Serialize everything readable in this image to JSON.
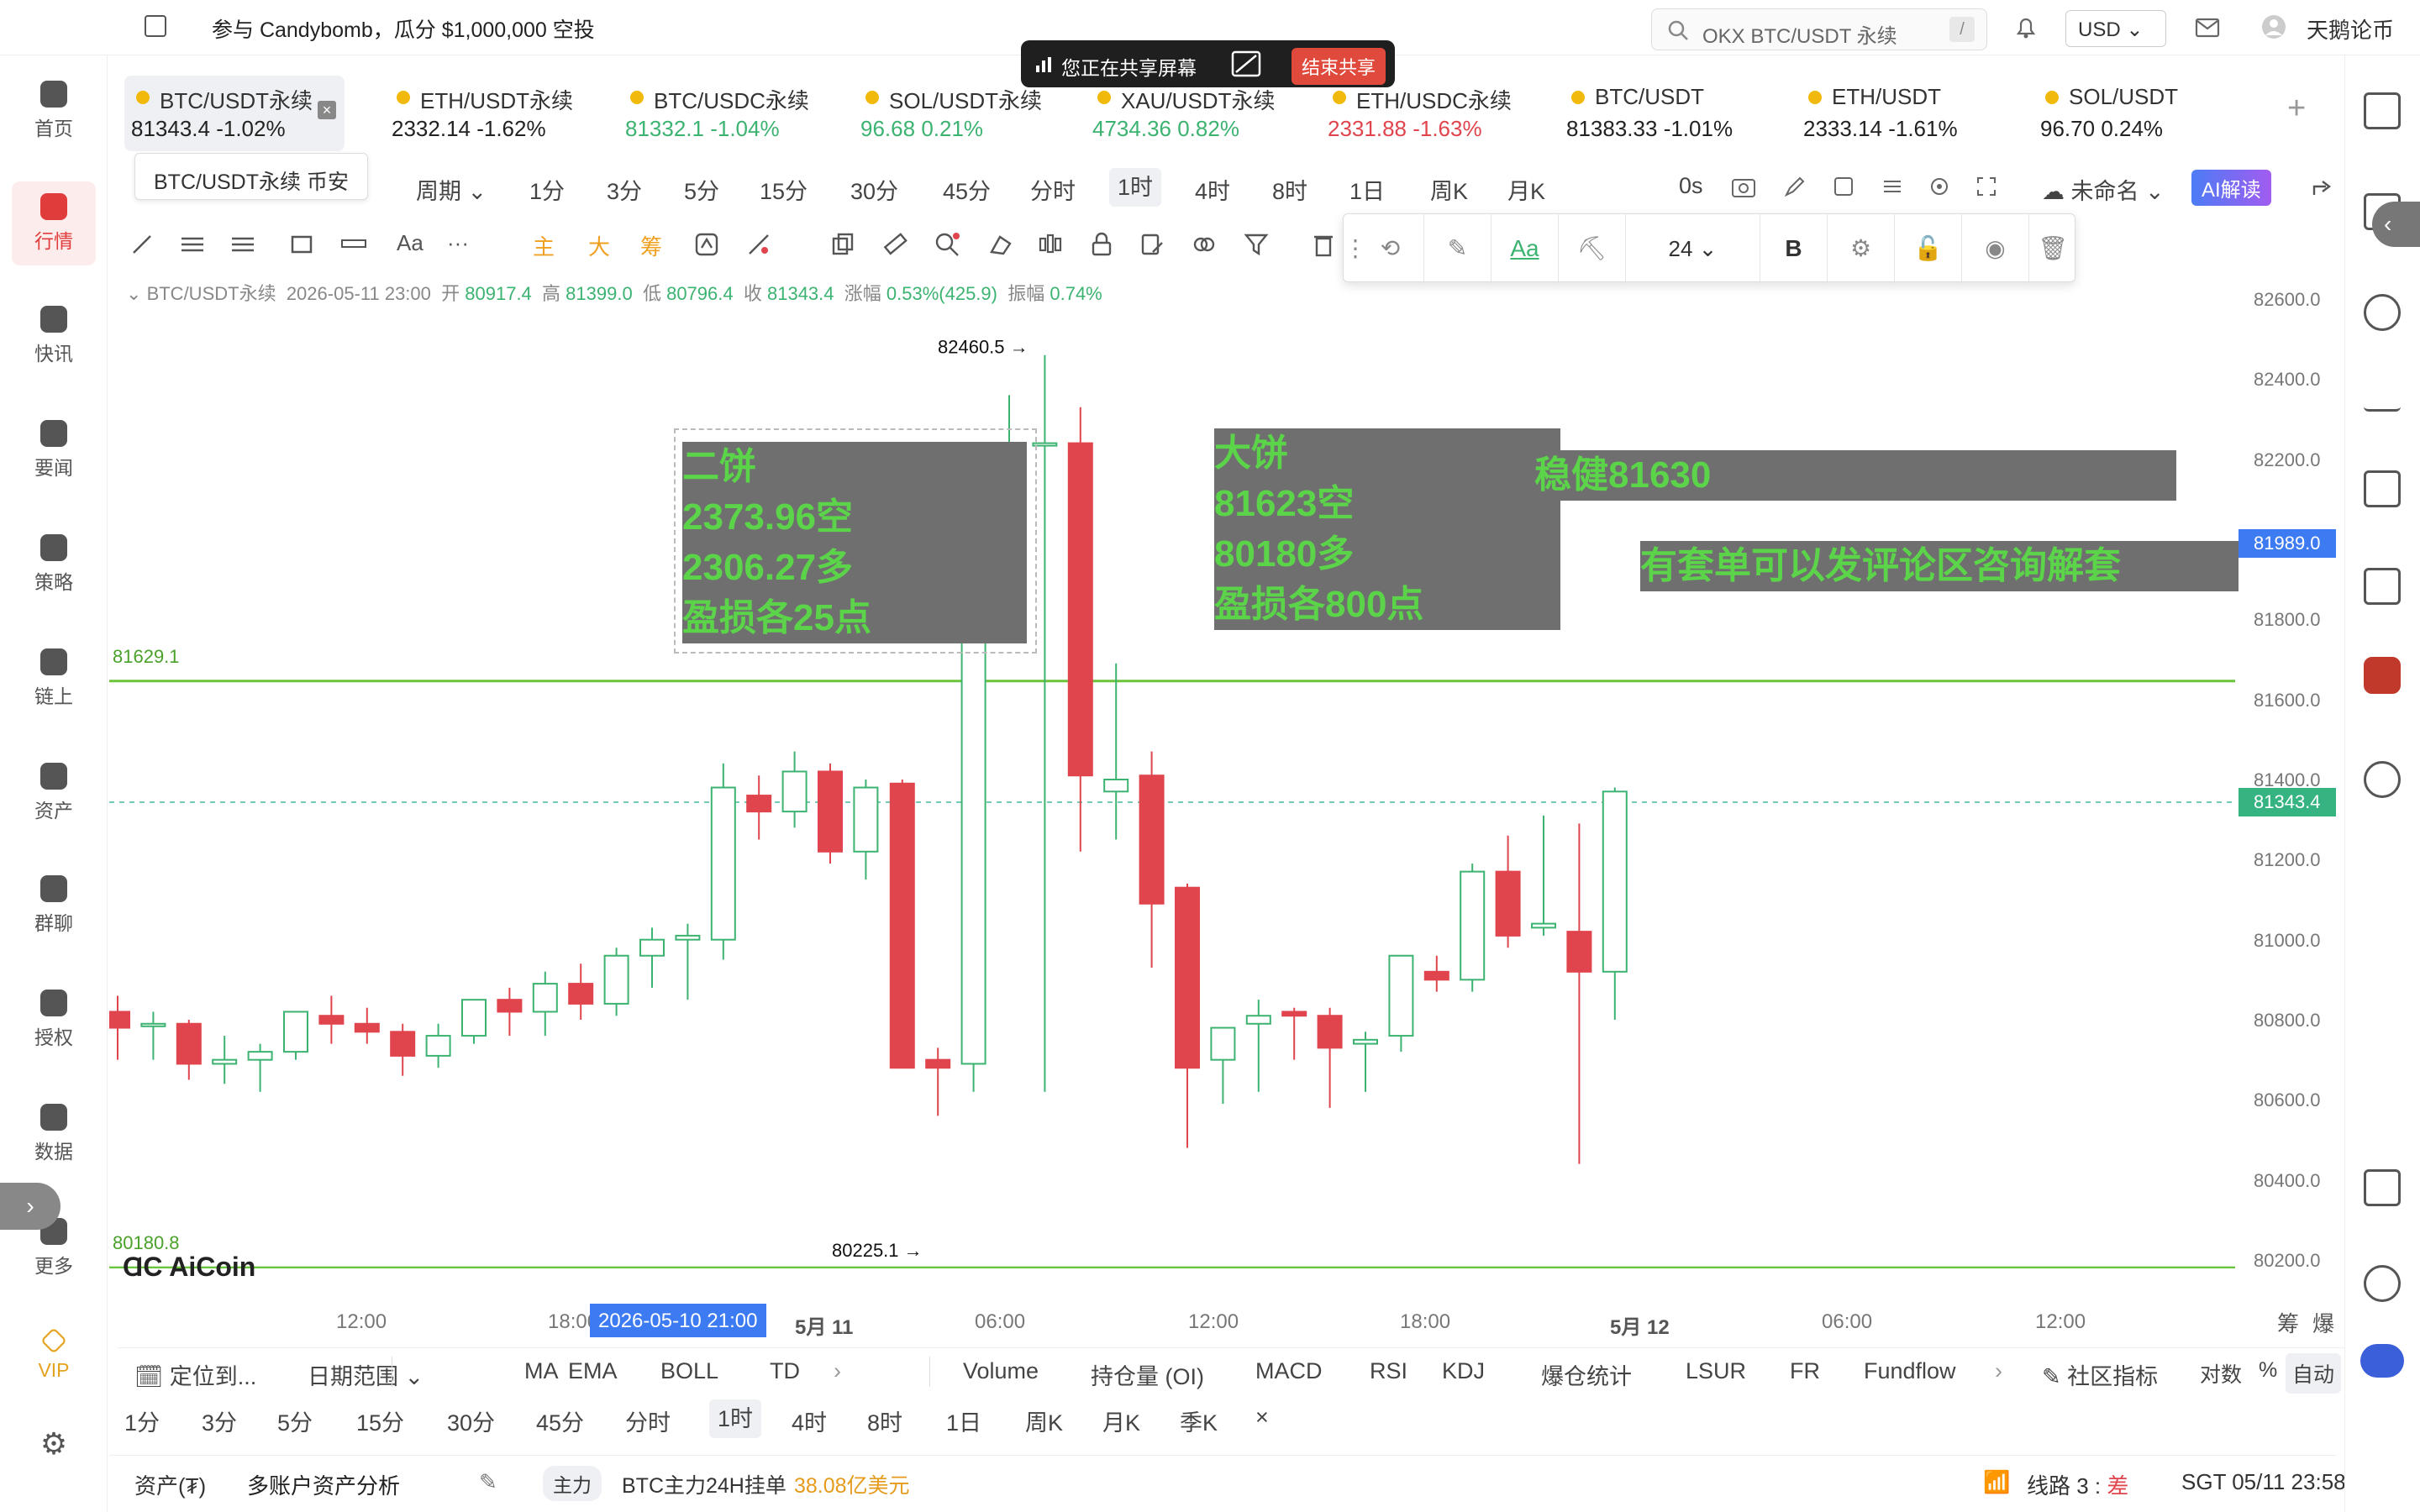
{
  "topbar": {
    "promo": "参与 Candybomb，瓜分 $1,000,000 空投",
    "search_placeholder": "OKX BTC/USDT 永续",
    "search_shortcut": "/",
    "currency": "USD",
    "user": "天鹅论币"
  },
  "share_bar": {
    "text": "您正在共享屏幕",
    "end_label": "结束共享"
  },
  "leftnav": [
    {
      "label": "首页",
      "icon": "home-icon"
    },
    {
      "label": "行情",
      "icon": "market-chart-icon",
      "active": true
    },
    {
      "label": "快讯",
      "icon": "flash-news-icon"
    },
    {
      "label": "要闻",
      "icon": "news-icon"
    },
    {
      "label": "策略",
      "icon": "robot-strategy-icon"
    },
    {
      "label": "链上",
      "icon": "onchain-icon"
    },
    {
      "label": "资产",
      "icon": "wallet-icon"
    },
    {
      "label": "群聊",
      "icon": "chat-icon"
    },
    {
      "label": "授权",
      "icon": "key-icon"
    },
    {
      "label": "数据",
      "icon": "data-icon"
    },
    {
      "label": "更多",
      "icon": "more-grid-icon"
    },
    {
      "label": "VIP",
      "icon": "vip-diamond-icon"
    }
  ],
  "tickers": [
    {
      "name": "BTC/USDT永续",
      "price": "81343.4",
      "change": "-1.02%",
      "dir": "down",
      "active": true
    },
    {
      "name": "ETH/USDT永续",
      "price": "2332.14",
      "change": "-1.62%",
      "dir": "down"
    },
    {
      "name": "BTC/USDC永续",
      "price": "81332.1",
      "change": "-1.04%",
      "dir": "up"
    },
    {
      "name": "SOL/USDT永续",
      "price": "96.68",
      "change": "0.21%",
      "dir": "up"
    },
    {
      "name": "XAU/USDT永续",
      "price": "4734.36",
      "change": "0.82%",
      "dir": "up"
    },
    {
      "name": "ETH/USDC永续",
      "price": "2331.88",
      "change": "-1.63%",
      "dir": "down2"
    },
    {
      "name": "BTC/USDT",
      "price": "81383.33",
      "change": "-1.01%",
      "dir": "down"
    },
    {
      "name": "ETH/USDT",
      "price": "2333.14",
      "change": "-1.61%",
      "dir": "down"
    },
    {
      "name": "SOL/USDT",
      "price": "96.70",
      "change": "0.24%",
      "dir": "down"
    }
  ],
  "tooltip": "BTC/USDT永续 币安",
  "periods": {
    "cycle": "周期",
    "items": [
      "1分",
      "3分",
      "5分",
      "15分",
      "30分",
      "45分",
      "分时",
      "1时",
      "4时",
      "8时",
      "1日",
      "周K",
      "月K"
    ],
    "selected": "1时",
    "countdown": "0s",
    "layout_name": "未命名",
    "ai": "AI解读"
  },
  "drawbar": {
    "text_tool": "Aa",
    "more": "···",
    "main": "主",
    "big": "大",
    "chip": "筹"
  },
  "textpanel": {
    "font_size": "24",
    "bold": "B"
  },
  "ohlc": {
    "symbol": "BTC/USDT永续",
    "time": "2026-05-11 23:00",
    "open_label": "开",
    "open": "80917.4",
    "high_label": "高",
    "high": "81399.0",
    "low_label": "低",
    "low": "80796.4",
    "close_label": "收",
    "close": "81343.4",
    "chg_label": "涨幅",
    "chg": "0.53%(425.9)",
    "amp_label": "振幅",
    "amp": "0.74%"
  },
  "chart_data": {
    "type": "candlestick",
    "ylim": [
      80100,
      82700
    ],
    "yticks": [
      "82600.0",
      "82400.0",
      "82200.0",
      "82000.0",
      "81800.0",
      "81600.0",
      "81400.0",
      "81200.0",
      "81000.0",
      "80800.0",
      "80600.0",
      "80400.0",
      "80200.0"
    ],
    "xticks": [
      "12:00",
      "18:00",
      "5月 11",
      "06:00",
      "12:00",
      "18:00",
      "5月 12",
      "06:00",
      "12:00"
    ],
    "x_cursor": "2026-05-10 21:00",
    "current_price": "81343.4",
    "crosshair_price": "81989.0",
    "hlines": [
      {
        "label": "81629.1",
        "value": 81629.1
      },
      {
        "label": "80180.8",
        "value": 80180.8
      }
    ],
    "high_marker": "82460.5",
    "low_marker": "80225.1",
    "candles": [
      [
        80820,
        80860,
        80700,
        80780
      ],
      [
        80790,
        80820,
        80700,
        80790
      ],
      [
        80790,
        80800,
        80650,
        80690
      ],
      [
        80690,
        80760,
        80640,
        80700
      ],
      [
        80700,
        80740,
        80620,
        80720
      ],
      [
        80720,
        80820,
        80700,
        80820
      ],
      [
        80810,
        80860,
        80740,
        80790
      ],
      [
        80790,
        80830,
        80740,
        80770
      ],
      [
        80770,
        80790,
        80660,
        80710
      ],
      [
        80710,
        80790,
        80680,
        80760
      ],
      [
        80760,
        80850,
        80740,
        80850
      ],
      [
        80850,
        80880,
        80760,
        80820
      ],
      [
        80820,
        80920,
        80760,
        80890
      ],
      [
        80890,
        80940,
        80800,
        80840
      ],
      [
        80840,
        80980,
        80810,
        80960
      ],
      [
        80960,
        81030,
        80880,
        81000
      ],
      [
        81000,
        81040,
        80850,
        81010
      ],
      [
        81000,
        81440,
        80950,
        81380
      ],
      [
        81360,
        81410,
        81250,
        81320
      ],
      [
        81320,
        81470,
        81280,
        81420
      ],
      [
        81420,
        81440,
        81190,
        81220
      ],
      [
        81220,
        81400,
        81150,
        81380
      ],
      [
        81390,
        81400,
        80680,
        80680
      ],
      [
        80700,
        80730,
        80560,
        80680
      ],
      [
        80690,
        82050,
        80620,
        82010
      ],
      [
        82010,
        82360,
        82090,
        82180
      ],
      [
        82240,
        82460,
        80620,
        82240
      ],
      [
        82240,
        82330,
        81220,
        81410
      ],
      [
        81370,
        81690,
        81250,
        81400
      ],
      [
        81410,
        81470,
        80930,
        81090
      ],
      [
        81130,
        81140,
        80480,
        80680
      ],
      [
        80700,
        80760,
        80590,
        80780
      ],
      [
        80790,
        80850,
        80620,
        80810
      ],
      [
        80820,
        80830,
        80700,
        80810
      ],
      [
        80810,
        80830,
        80580,
        80730
      ],
      [
        80740,
        80770,
        80620,
        80750
      ],
      [
        80760,
        80960,
        80720,
        80960
      ],
      [
        80920,
        80960,
        80870,
        80900
      ],
      [
        80900,
        81190,
        80870,
        81170
      ],
      [
        81170,
        81260,
        80980,
        81010
      ],
      [
        81030,
        81310,
        81010,
        81040
      ],
      [
        81020,
        81290,
        80440,
        80920
      ],
      [
        80920,
        81380,
        80800,
        81370
      ]
    ]
  },
  "notes": {
    "er": [
      "二饼",
      "2373.96空",
      "2306.27多",
      "盈损各25点"
    ],
    "da": [
      "大饼",
      "81623空",
      "80180多",
      "盈损各800点"
    ],
    "wen": "稳健81630",
    "tao": "有套单可以发评论区咨询解套"
  },
  "brand": "AiCoin",
  "xaxis_right": [
    "筹",
    "爆"
  ],
  "indicators": {
    "locate": "定位到...",
    "date_range": "日期范围",
    "main": [
      "MA",
      "EMA",
      "BOLL",
      "TD"
    ],
    "sub": [
      "Volume",
      "持仓量 (OI)",
      "MACD",
      "RSI",
      "KDJ",
      "爆仓统计",
      "LSUR",
      "FR",
      "Fundflow"
    ],
    "community": "社区指标",
    "log": "对数",
    "pct": "%",
    "auto": "自动"
  },
  "periods2": {
    "items": [
      "1分",
      "3分",
      "5分",
      "15分",
      "30分",
      "45分",
      "分时",
      "1时",
      "4时",
      "8时",
      "1日",
      "周K",
      "月K",
      "季K"
    ],
    "selected": "1时",
    "close": "×"
  },
  "statusbar": {
    "assets": "资产(₮)",
    "multi": "多账户资产分析",
    "main_tag": "主力",
    "order_label": "BTC主力24H挂单",
    "order_value": "38.08亿美元",
    "line": "线路 3 :",
    "line_status": "差",
    "clock": "SGT 05/11 23:58:18"
  },
  "colors": {
    "up": "#3cb371",
    "down": "#e0444d",
    "accent": "#3d7bf2",
    "note_text": "#5bd44a",
    "hline": "#6ac43c"
  }
}
